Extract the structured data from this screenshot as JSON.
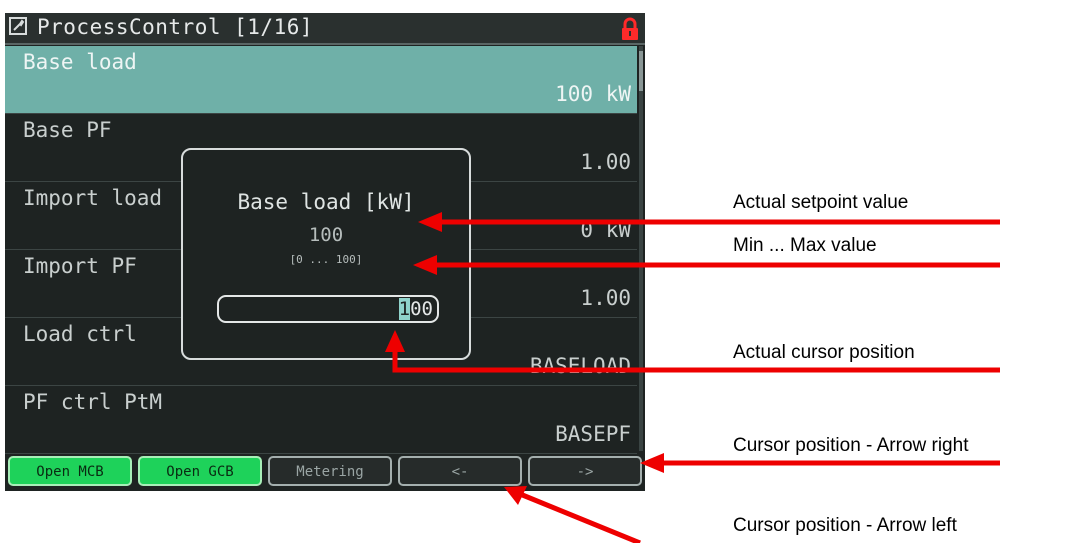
{
  "titlebar": {
    "icon": "wrench-icon",
    "title": "ProcessControl [1/16]",
    "lock_icon": "lock-icon"
  },
  "rows": [
    {
      "name": "Base load",
      "value": "100 kW"
    },
    {
      "name": "Base PF",
      "value": "1.00"
    },
    {
      "name": "Import load",
      "value": "0 kW"
    },
    {
      "name": "Import PF",
      "value": "1.00"
    },
    {
      "name": "Load ctrl",
      "value": "BASELOAD"
    },
    {
      "name": "PF ctrl PtM",
      "value": "BASEPF"
    }
  ],
  "popup": {
    "title": "Base load [kW]",
    "value": "100",
    "range": "[0 ... 100]",
    "edit_digit_cursor": "1",
    "edit_digit_rest": "00"
  },
  "softkeys": [
    "Open MCB",
    "Open GCB",
    "Metering",
    "<-",
    "->"
  ],
  "annotations": {
    "setpoint": "Actual setpoint value",
    "minmax": "Min ... Max value",
    "cursor": "Actual cursor position",
    "arrow_right": "Cursor position - Arrow right",
    "arrow_left": "Cursor position - Arrow left"
  },
  "colors": {
    "selected_row": "#6fb0a8",
    "softkey_green": "#1ed25a",
    "lock": "#ff2a2a",
    "arrow": "#ee0000"
  }
}
